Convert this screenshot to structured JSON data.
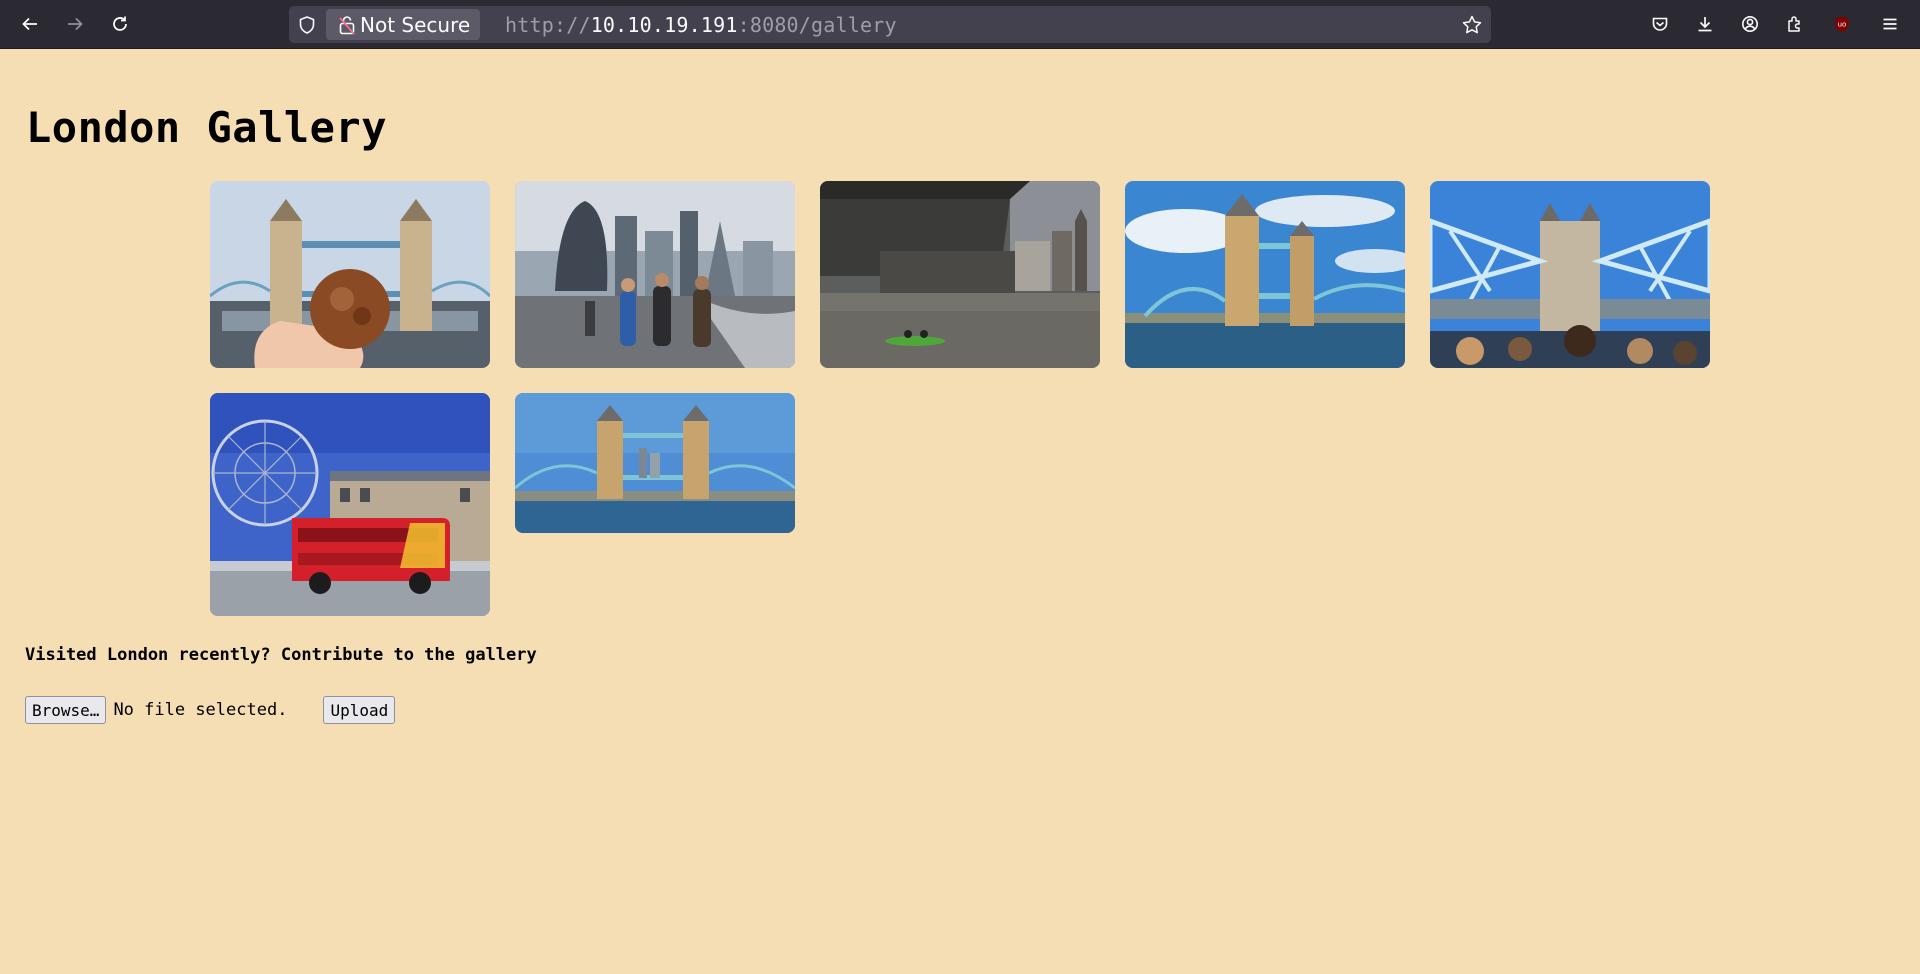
{
  "browser": {
    "security_label": "Not Secure",
    "url_scheme": "http://",
    "url_host": "10.10.19.191",
    "url_rest": ":8080/gallery",
    "icons": [
      "back-icon",
      "forward-icon",
      "reload-icon",
      "shield-icon",
      "lock-icon",
      "bookmark-star-icon",
      "pocket-icon",
      "download-icon",
      "account-icon",
      "extensions-icon",
      "ublock-icon",
      "menu-icon"
    ]
  },
  "page": {
    "title": "London Gallery",
    "cta": "Visited London recently? Contribute to the gallery",
    "browse_label": "Browse…",
    "file_status": "No file selected.",
    "upload_label": "Upload"
  },
  "gallery": {
    "images": [
      {
        "subject": "Tower Bridge with pastry in hand"
      },
      {
        "subject": "City of London skyline with pedestrians"
      },
      {
        "subject": "Under London Bridge with kayak"
      },
      {
        "subject": "Tower Bridge under blue sky"
      },
      {
        "subject": "Tower Bridge from a boat"
      },
      {
        "subject": "London Eye and red sightseeing bus"
      },
      {
        "subject": "Tower Bridge panorama"
      }
    ]
  },
  "colors": {
    "page_bg": "#f5deb3",
    "toolbar_bg": "#2b2a33",
    "urlbar_bg": "#42414d"
  }
}
